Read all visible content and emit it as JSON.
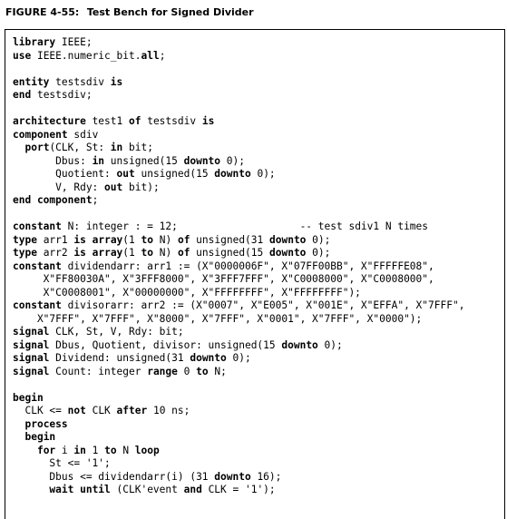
{
  "figure": {
    "number": "FIGURE 4-55:",
    "title": "Test Bench for Signed Divider"
  },
  "code_lines": [
    [
      {
        "t": "library",
        "k": 1
      },
      {
        "t": " IEEE;"
      }
    ],
    [
      {
        "t": "use",
        "k": 1
      },
      {
        "t": " IEEE.numeric_bit."
      },
      {
        "t": "all",
        "k": 1
      },
      {
        "t": ";"
      }
    ],
    [],
    [
      {
        "t": "entity",
        "k": 1
      },
      {
        "t": " testsdiv "
      },
      {
        "t": "is",
        "k": 1
      }
    ],
    [
      {
        "t": "end",
        "k": 1
      },
      {
        "t": " testsdiv;"
      }
    ],
    [],
    [
      {
        "t": "architecture",
        "k": 1
      },
      {
        "t": " test1 "
      },
      {
        "t": "of",
        "k": 1
      },
      {
        "t": " testsdiv "
      },
      {
        "t": "is",
        "k": 1
      }
    ],
    [
      {
        "t": "component",
        "k": 1
      },
      {
        "t": " sdiv"
      }
    ],
    [
      {
        "t": "  "
      },
      {
        "t": "port",
        "k": 1
      },
      {
        "t": "(CLK, St: "
      },
      {
        "t": "in",
        "k": 1
      },
      {
        "t": " bit;"
      }
    ],
    [
      {
        "t": "       Dbus: "
      },
      {
        "t": "in",
        "k": 1
      },
      {
        "t": " unsigned(15 "
      },
      {
        "t": "downto",
        "k": 1
      },
      {
        "t": " 0);"
      }
    ],
    [
      {
        "t": "       Quotient: "
      },
      {
        "t": "out",
        "k": 1
      },
      {
        "t": " unsigned(15 "
      },
      {
        "t": "downto",
        "k": 1
      },
      {
        "t": " 0);"
      }
    ],
    [
      {
        "t": "       V, Rdy: "
      },
      {
        "t": "out",
        "k": 1
      },
      {
        "t": " bit);"
      }
    ],
    [
      {
        "t": "end component",
        "k": 1
      },
      {
        "t": ";"
      }
    ],
    [],
    [
      {
        "t": "constant",
        "k": 1
      },
      {
        "t": " N: integer : = 12;                    -- test sdiv1 N times"
      }
    ],
    [
      {
        "t": "type",
        "k": 1
      },
      {
        "t": " arr1 "
      },
      {
        "t": "is",
        "k": 1
      },
      {
        "t": " "
      },
      {
        "t": "array",
        "k": 1
      },
      {
        "t": "(1 "
      },
      {
        "t": "to",
        "k": 1
      },
      {
        "t": " N) "
      },
      {
        "t": "of",
        "k": 1
      },
      {
        "t": " unsigned(31 "
      },
      {
        "t": "downto",
        "k": 1
      },
      {
        "t": " 0);"
      }
    ],
    [
      {
        "t": "type",
        "k": 1
      },
      {
        "t": " arr2 "
      },
      {
        "t": "is",
        "k": 1
      },
      {
        "t": " "
      },
      {
        "t": "array",
        "k": 1
      },
      {
        "t": "(1 "
      },
      {
        "t": "to",
        "k": 1
      },
      {
        "t": " N) "
      },
      {
        "t": "of",
        "k": 1
      },
      {
        "t": " unsigned(15 "
      },
      {
        "t": "downto",
        "k": 1
      },
      {
        "t": " 0);"
      }
    ],
    [
      {
        "t": "constant",
        "k": 1
      },
      {
        "t": " dividendarr: arr1 := (X\"0000006F\", X\"07FF00BB\", X\"FFFFFE08\","
      }
    ],
    [
      {
        "t": "     X\"FF80030A\", X\"3FFF8000\", X\"3FFF7FFF\", X\"C0008000\", X\"C0008000\","
      }
    ],
    [
      {
        "t": "     X\"C0008001\", X\"00000000\", X\"FFFFFFFF\", X\"FFFFFFFF\");"
      }
    ],
    [
      {
        "t": "constant",
        "k": 1
      },
      {
        "t": " divisorarr: arr2 := (X\"0007\", X\"E005\", X\"001E\", X\"EFFA\", X\"7FFF\","
      }
    ],
    [
      {
        "t": "    X\"7FFF\", X\"7FFF\", X\"8000\", X\"7FFF\", X\"0001\", X\"7FFF\", X\"0000\");"
      }
    ],
    [
      {
        "t": "signal",
        "k": 1
      },
      {
        "t": " CLK, St, V, Rdy: bit;"
      }
    ],
    [
      {
        "t": "signal",
        "k": 1
      },
      {
        "t": " Dbus, Quotient, divisor: unsigned(15 "
      },
      {
        "t": "downto",
        "k": 1
      },
      {
        "t": " 0);"
      }
    ],
    [
      {
        "t": "signal",
        "k": 1
      },
      {
        "t": " Dividend: unsigned(31 "
      },
      {
        "t": "downto",
        "k": 1
      },
      {
        "t": " 0);"
      }
    ],
    [
      {
        "t": "signal",
        "k": 1
      },
      {
        "t": " Count: integer "
      },
      {
        "t": "range",
        "k": 1
      },
      {
        "t": " 0 "
      },
      {
        "t": "to",
        "k": 1
      },
      {
        "t": " N;"
      }
    ],
    [],
    [
      {
        "t": "begin",
        "k": 1
      }
    ],
    [
      {
        "t": "  CLK <= "
      },
      {
        "t": "not",
        "k": 1
      },
      {
        "t": " CLK "
      },
      {
        "t": "after",
        "k": 1
      },
      {
        "t": " 10 ns;"
      }
    ],
    [
      {
        "t": "  "
      },
      {
        "t": "process",
        "k": 1
      }
    ],
    [
      {
        "t": "  "
      },
      {
        "t": "begin",
        "k": 1
      }
    ],
    [
      {
        "t": "    "
      },
      {
        "t": "for",
        "k": 1
      },
      {
        "t": " i "
      },
      {
        "t": "in",
        "k": 1
      },
      {
        "t": " 1 "
      },
      {
        "t": "to",
        "k": 1
      },
      {
        "t": " N "
      },
      {
        "t": "loop",
        "k": 1
      }
    ],
    [
      {
        "t": "      St <= '1';"
      }
    ],
    [
      {
        "t": "      Dbus <= dividendarr(i) (31 "
      },
      {
        "t": "downto",
        "k": 1
      },
      {
        "t": " 16);"
      }
    ],
    [
      {
        "t": "      "
      },
      {
        "t": "wait until",
        "k": 1
      },
      {
        "t": " (CLK'event "
      },
      {
        "t": "and",
        "k": 1
      },
      {
        "t": " CLK = '1');"
      }
    ]
  ]
}
